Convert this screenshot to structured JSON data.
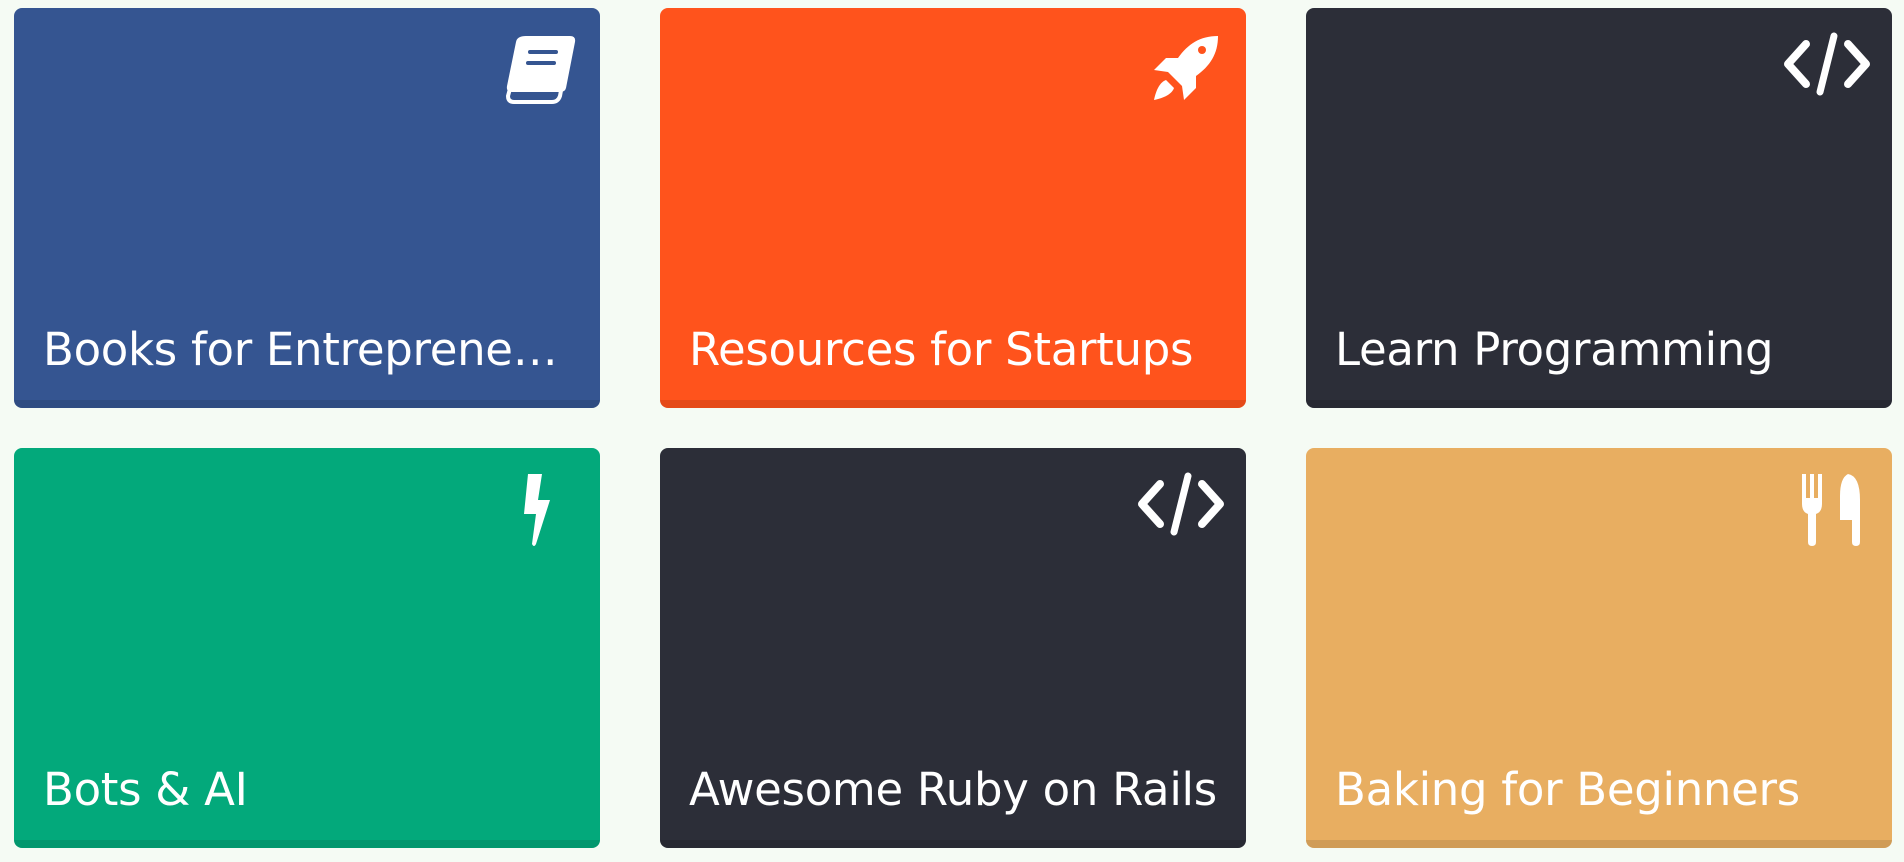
{
  "cards": [
    {
      "title": "Books for Entrepreneurs",
      "icon": "book-icon",
      "color": "#355591"
    },
    {
      "title": "Resources for Startups",
      "icon": "rocket-icon",
      "color": "#ff531c"
    },
    {
      "title": "Learn Programming",
      "icon": "code-icon",
      "color": "#2c2e38"
    },
    {
      "title": "Bots & AI",
      "icon": "bolt-icon",
      "color": "#03a97b"
    },
    {
      "title": "Awesome Ruby on Rails",
      "icon": "code-icon",
      "color": "#2c2e38"
    },
    {
      "title": "Baking for Beginners",
      "icon": "utensils-icon",
      "color": "#e8ae61"
    }
  ]
}
